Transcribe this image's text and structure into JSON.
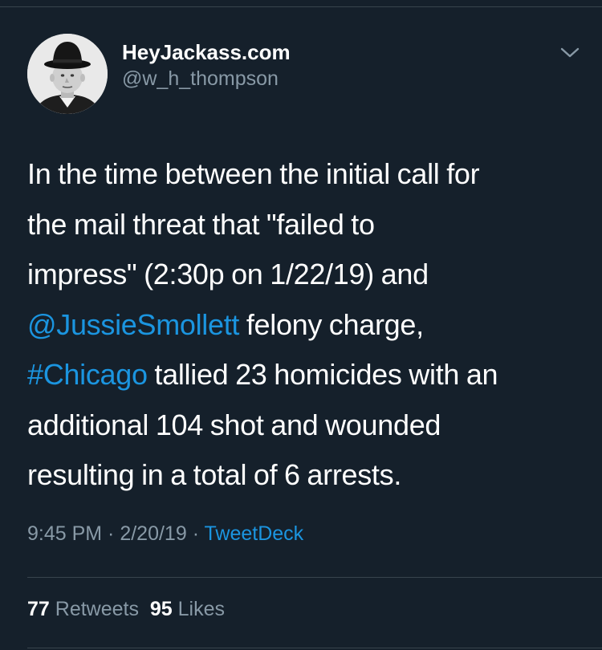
{
  "colors": {
    "background": "#15202b",
    "text": "#ffffff",
    "secondary": "#8899a6",
    "link": "#1b95e0",
    "divider": "#38444d"
  },
  "author": {
    "display_name": "HeyJackass.com",
    "handle": "@w_h_thompson",
    "avatar_icon": "avatar-man-in-bowler-hat"
  },
  "menu": {
    "icon": "chevron-down-icon"
  },
  "tweet": {
    "lines": [
      {
        "text": "In the time between the initial call for"
      },
      {
        "text": "the mail threat that \"failed to"
      },
      {
        "text": "impress\" (2:30p on 1/22/19) and"
      },
      {
        "mention": "@JussieSmollett",
        "text": " felony charge,"
      },
      {
        "hashtag": "#Chicago",
        "text": " tallied 23 homicides with an"
      },
      {
        "text": "additional 104 shot and wounded"
      },
      {
        "text": "resulting in a total of 6 arrests."
      }
    ]
  },
  "meta": {
    "time": "9:45 PM",
    "separator": " · ",
    "date": "2/20/19",
    "source": "TweetDeck"
  },
  "stats": {
    "retweets_count": "77",
    "retweets_label": "Retweets",
    "likes_count": "95",
    "likes_label": "Likes"
  }
}
